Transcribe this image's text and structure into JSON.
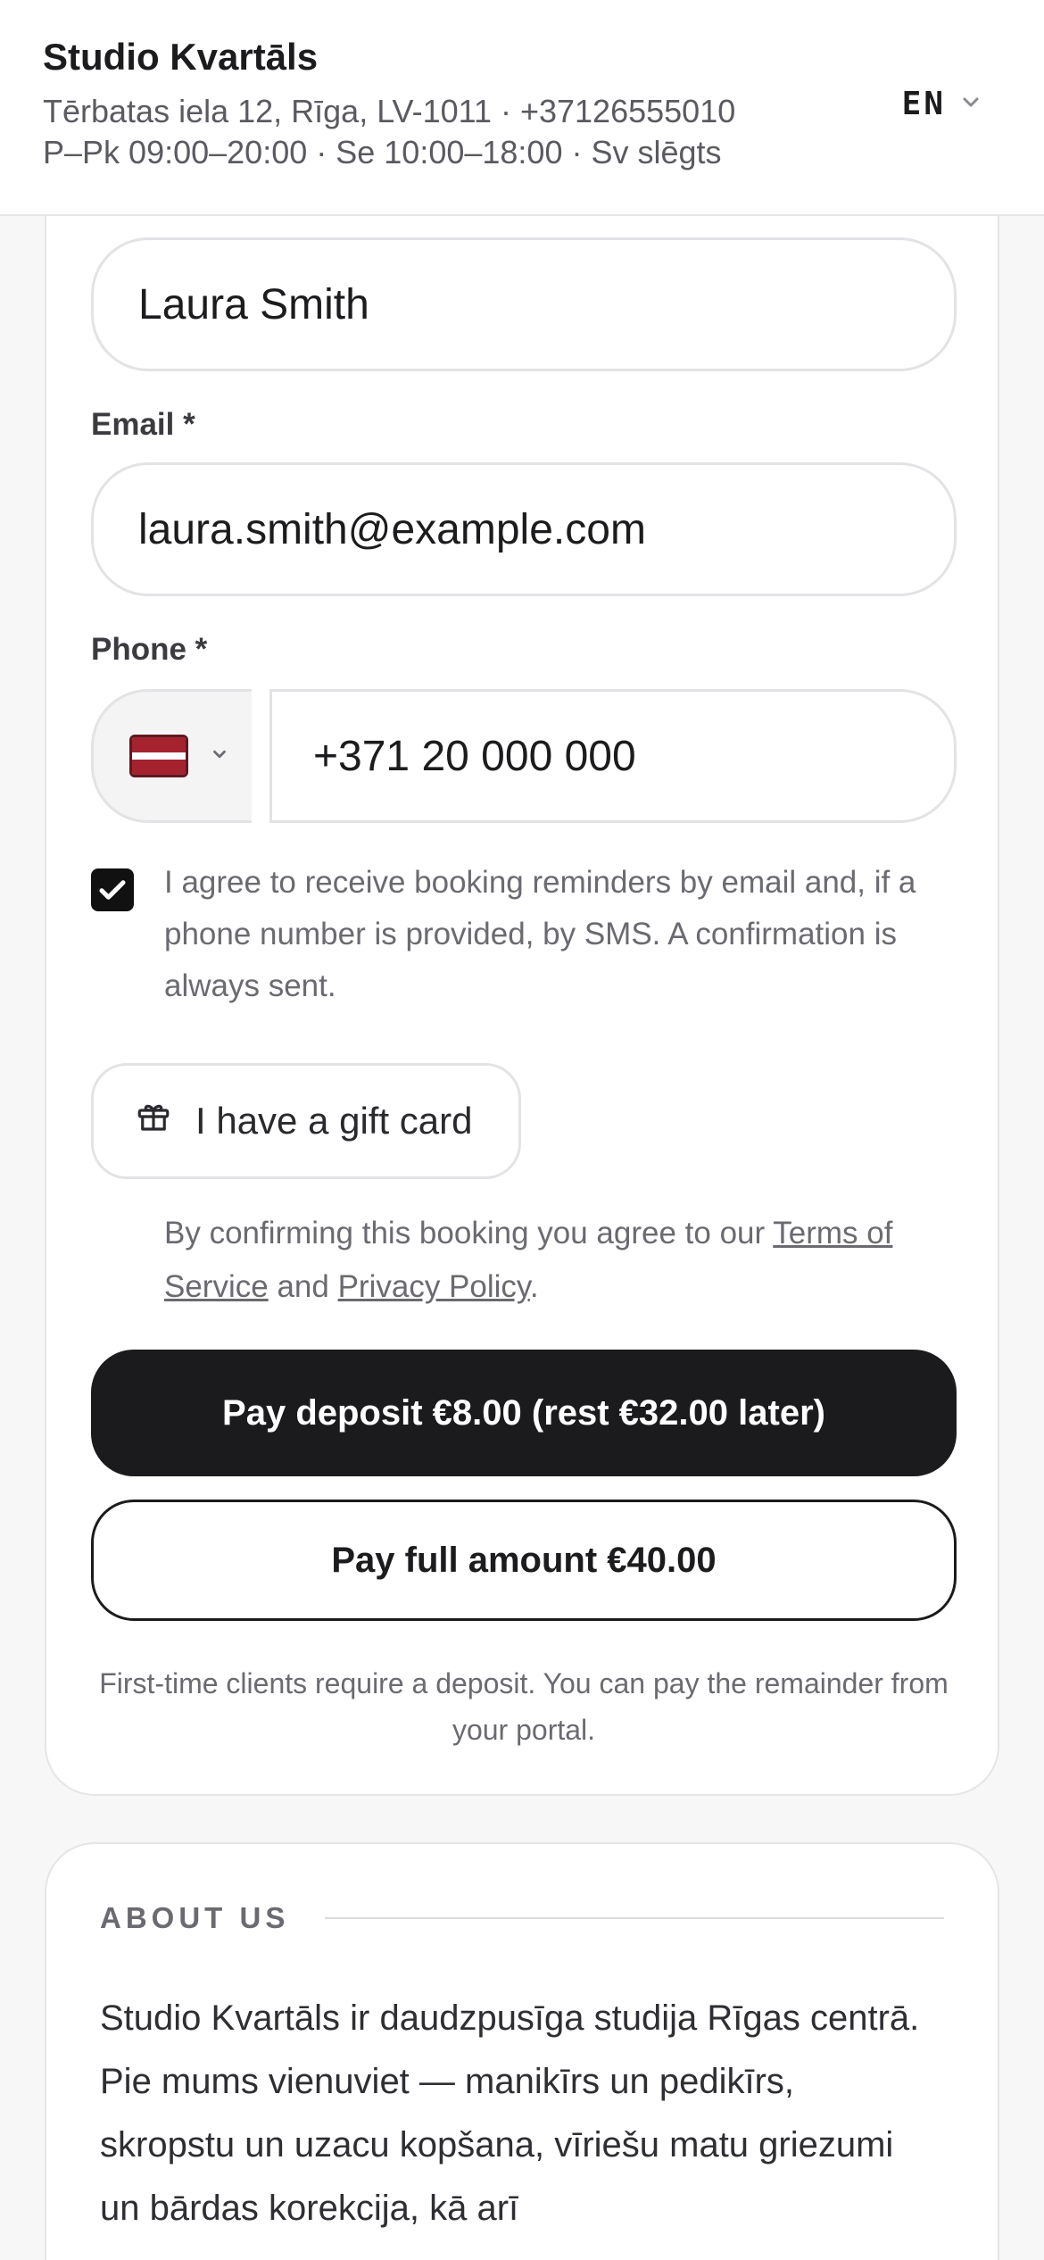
{
  "header": {
    "title": "Studio Kvartāls",
    "address": "Tērbatas iela 12, Rīga, LV-1011 · +37126555010",
    "hours": "P–Pk 09:00–20:00 · Se 10:00–18:00 · Sv slēgts",
    "language": "EN"
  },
  "form": {
    "name_value": "Laura Smith",
    "email_label": "Email *",
    "email_value": "laura.smith@example.com",
    "phone_label": "Phone *",
    "phone_country_flag": "flag-latvia",
    "phone_value": "+371 20 000 000",
    "consent_checked": true,
    "consent_text": "I agree to receive booking reminders by email and, if a phone number is provided, by SMS. A confirmation is always sent.",
    "gift_card_label": "I have a gift card",
    "terms_prefix": "By confirming this booking you agree to our ",
    "terms_link": "Terms of Service",
    "terms_middle": " and ",
    "privacy_link": "Privacy Policy",
    "terms_suffix": ".",
    "pay_deposit_label": "Pay deposit €8.00 (rest €32.00 later)",
    "pay_full_label": "Pay full amount €40.00",
    "deposit_note": "First-time clients require a deposit. You can pay the remainder from your portal."
  },
  "about": {
    "heading": "ABOUT US",
    "text": "Studio Kvartāls ir daudzpusīga studija Rīgas centrā. Pie mums vienuviet — manikīrs un pedikīrs, skropstu un uzacu kopšana, vīriešu matu griezumi un bārdas korekcija, kā arī"
  },
  "colors": {
    "primary_button": "#1b1b1d",
    "muted_text": "#6a6a70",
    "border": "#e3e3e6",
    "flag_red": "#a4232f"
  }
}
